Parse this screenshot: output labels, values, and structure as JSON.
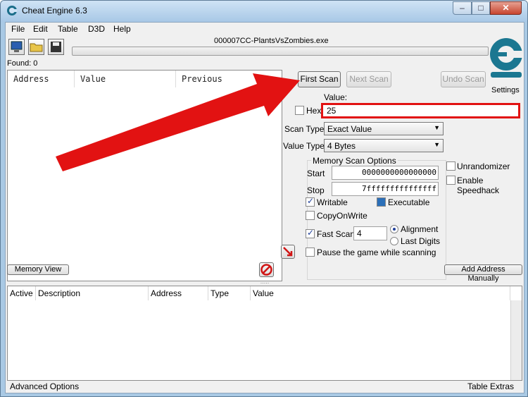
{
  "window": {
    "title": "Cheat Engine 6.3",
    "minimize": "–",
    "maximize": "□",
    "close": "✕"
  },
  "menu": [
    "File",
    "Edit",
    "Table",
    "D3D",
    "Help"
  ],
  "process_title": "000007CC-PlantsVsZombies.exe",
  "found_label": "Found: 0",
  "settings_label": "Settings",
  "results_columns": [
    "Address",
    "Value",
    "Previous"
  ],
  "buttons": {
    "first_scan": "First Scan",
    "next_scan": "Next Scan",
    "undo_scan": "Undo Scan",
    "memory_view": "Memory View",
    "add_address": "Add Address Manually"
  },
  "value": {
    "label": "Value:",
    "hex_label": "Hex",
    "input": "25"
  },
  "scan_type": {
    "label": "Scan Type",
    "selected": "Exact Value"
  },
  "value_type": {
    "label": "Value Type",
    "selected": "4 Bytes"
  },
  "memory_options": {
    "title": "Memory Scan Options",
    "start_label": "Start",
    "start_value": "0000000000000000",
    "stop_label": "Stop",
    "stop_value": "7fffffffffffffff",
    "writable": "Writable",
    "executable": "Executable",
    "copy_on_write": "CopyOnWrite",
    "fast_scan": "Fast Scan",
    "fast_scan_value": "4",
    "alignment": "Alignment",
    "last_digits": "Last Digits",
    "pause": "Pause the game while scanning"
  },
  "side_options": {
    "unrandomizer": "Unrandomizer",
    "speedhack": "Enable Speedhack"
  },
  "table_columns": [
    "Active",
    "Description",
    "Address",
    "Type",
    "Value"
  ],
  "status": {
    "left": "Advanced Options",
    "right": "Table Extras"
  },
  "colors": {
    "annotation": "#e21212",
    "title_bar": "#a8c8e6"
  }
}
